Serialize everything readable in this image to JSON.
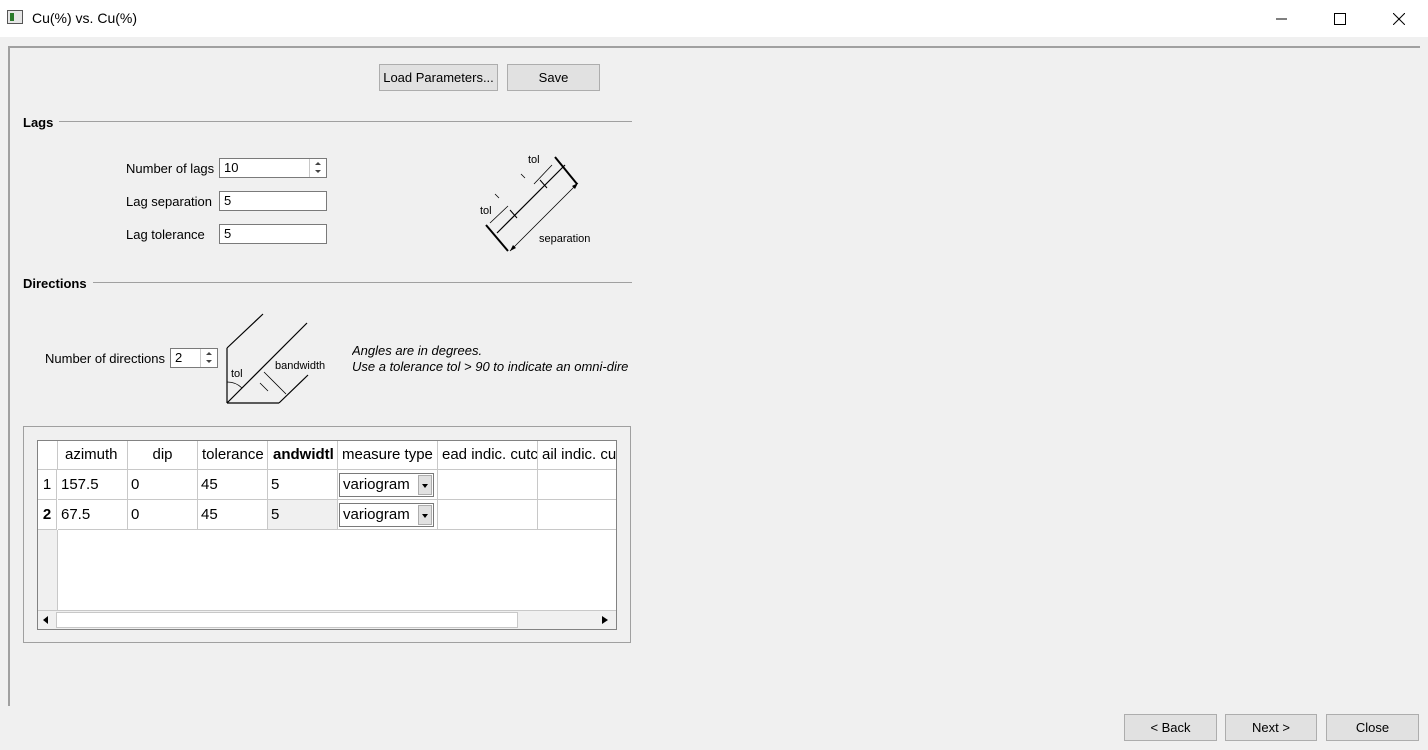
{
  "window": {
    "title": "Cu(%) vs. Cu(%)"
  },
  "toolbar": {
    "load_label": "Load Parameters...",
    "save_label": "Save"
  },
  "lags": {
    "section_title": "Lags",
    "num_lags_label": "Number of lags",
    "num_lags_value": "10",
    "separation_label": "Lag separation",
    "separation_value": "5",
    "tolerance_label": "Lag tolerance",
    "tolerance_value": "5",
    "diagram": {
      "tol_top": "tol",
      "tol_left": "tol",
      "separation": "separation"
    }
  },
  "directions": {
    "section_title": "Directions",
    "num_label": "Number of directions",
    "num_value": "2",
    "diagram": {
      "tol": "tol",
      "bandwidth": "bandwidth"
    },
    "note_line1": "Angles are in degrees.",
    "note_line2": "Use a tolerance tol > 90 to indicate an omni-dire"
  },
  "table": {
    "columns": [
      "azimuth",
      "dip",
      "tolerance",
      "andwidtl",
      "measure type",
      "ead indic. cutc",
      "ail indic. cu"
    ],
    "rows": [
      {
        "num": "1",
        "azimuth": "157.5",
        "dip": "0",
        "tolerance": "45",
        "bandwidth": "5",
        "measure": "variogram",
        "head": "",
        "tail": ""
      },
      {
        "num": "2",
        "azimuth": "67.5",
        "dip": "0",
        "tolerance": "45",
        "bandwidth": "5",
        "measure": "variogram",
        "head": "",
        "tail": ""
      }
    ]
  },
  "nav": {
    "back_label": "< Back",
    "next_label": "Next >",
    "close_label": "Close"
  }
}
